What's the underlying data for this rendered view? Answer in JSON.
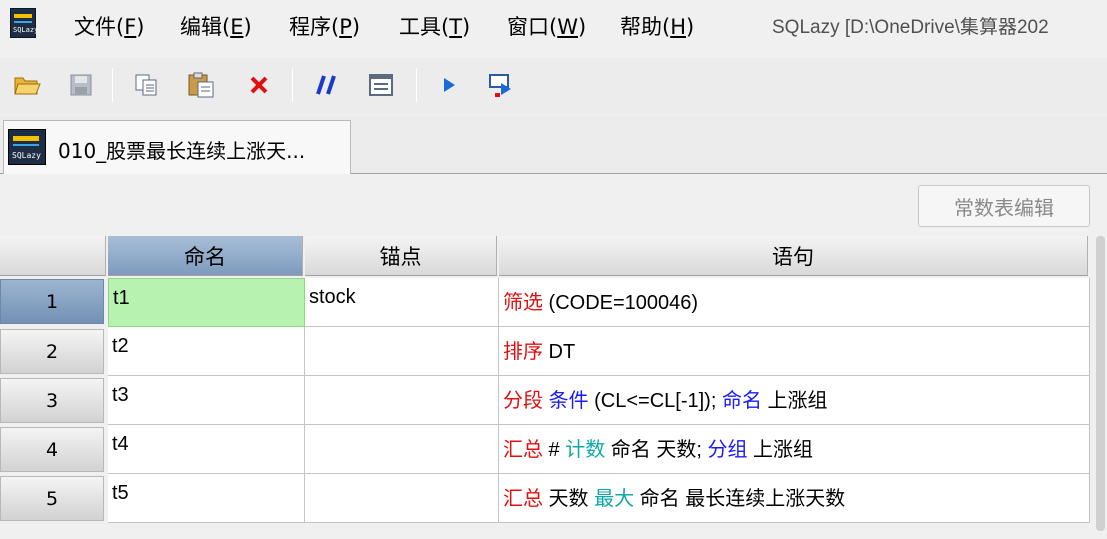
{
  "window": {
    "title": "SQLazy  [D:\\OneDrive\\集算器202",
    "app_icon_text": "SQLazy"
  },
  "menu": [
    {
      "label": "文件(",
      "key": "F",
      "suffix": ")"
    },
    {
      "label": "编辑(",
      "key": "E",
      "suffix": ")"
    },
    {
      "label": "程序(",
      "key": "P",
      "suffix": ")"
    },
    {
      "label": "工具(",
      "key": "T",
      "suffix": ")"
    },
    {
      "label": "窗口(",
      "key": "W",
      "suffix": ")"
    },
    {
      "label": "帮助(",
      "key": "H",
      "suffix": ")"
    }
  ],
  "toolbar": {
    "icons": [
      "open-folder-icon",
      "save-icon",
      "copy-icon",
      "paste-icon",
      "delete-icon",
      "comment-icon",
      "list-view-icon",
      "run-icon",
      "step-run-icon"
    ],
    "colors": {
      "delete": "#e01010",
      "comment": "#1a3acc",
      "run": "#1a6ad8"
    }
  },
  "tab": {
    "label": "010_股票最长连续上涨天...",
    "icon_text": "SQLazy"
  },
  "const_button": {
    "label": "常数表编辑"
  },
  "grid": {
    "headers": [
      "命名",
      "锚点",
      "语句"
    ],
    "rows": [
      {
        "num": "1",
        "name": "t1",
        "anchor": "stock",
        "stmt": [
          {
            "t": "筛选",
            "c": "red"
          },
          {
            "t": " (CODE=100046)",
            "c": "black"
          }
        ]
      },
      {
        "num": "2",
        "name": "t2",
        "anchor": "",
        "stmt": [
          {
            "t": "排序",
            "c": "red"
          },
          {
            "t": " DT",
            "c": "black"
          }
        ]
      },
      {
        "num": "3",
        "name": "t3",
        "anchor": "",
        "stmt": [
          {
            "t": "分段",
            "c": "red"
          },
          {
            "t": " ",
            "c": "black"
          },
          {
            "t": "条件",
            "c": "blue"
          },
          {
            "t": " (CL<=CL[-1]); ",
            "c": "black"
          },
          {
            "t": "命名",
            "c": "blue"
          },
          {
            "t": " 上涨组",
            "c": "black"
          }
        ]
      },
      {
        "num": "4",
        "name": "t4",
        "anchor": "",
        "stmt": [
          {
            "t": "汇总",
            "c": "red"
          },
          {
            "t": " # ",
            "c": "black"
          },
          {
            "t": "计数",
            "c": "teal"
          },
          {
            "t": " 命名 天数; ",
            "c": "black"
          },
          {
            "t": "分组",
            "c": "blue"
          },
          {
            "t": " 上涨组",
            "c": "black"
          }
        ]
      },
      {
        "num": "5",
        "name": "t5",
        "anchor": "",
        "stmt": [
          {
            "t": "汇总",
            "c": "red"
          },
          {
            "t": " 天数 ",
            "c": "black"
          },
          {
            "t": "最大",
            "c": "teal"
          },
          {
            "t": " 命名 最长连续上涨天数",
            "c": "black"
          }
        ]
      }
    ]
  }
}
